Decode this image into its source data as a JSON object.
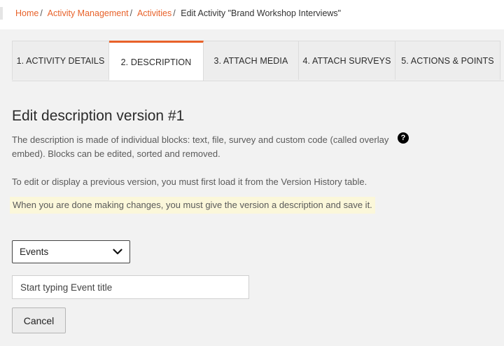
{
  "breadcrumb": {
    "home": "Home",
    "activity_management": "Activity Management",
    "activities": "Activities",
    "current": "Edit Activity \"Brand Workshop Interviews\"",
    "separator": "/"
  },
  "tabs": [
    {
      "label": "1. ACTIVITY DETAILS",
      "active": false
    },
    {
      "label": "2. DESCRIPTION",
      "active": true
    },
    {
      "label": "3. ATTACH MEDIA",
      "active": false
    },
    {
      "label": "4. ATTACH SURVEYS",
      "active": false
    },
    {
      "label": "5. ACTIONS & POINTS",
      "active": false
    }
  ],
  "main": {
    "title": "Edit description version #1",
    "help_icon_glyph": "?",
    "description": "The description is made of individual blocks: text, file, survey and custom code (called overlay embed). Blocks can be edited, sorted and removed.",
    "version_note": "To edit or display a previous version, you must first load it from the Version History table.",
    "save_note": "When you are done making changes, you must give the version a description and save it."
  },
  "form": {
    "type_select_value": "Events",
    "event_search_placeholder": "Start typing Event title",
    "cancel_label": "Cancel"
  },
  "colors": {
    "accent": "#e8622a",
    "highlight": "#fbf7da"
  }
}
